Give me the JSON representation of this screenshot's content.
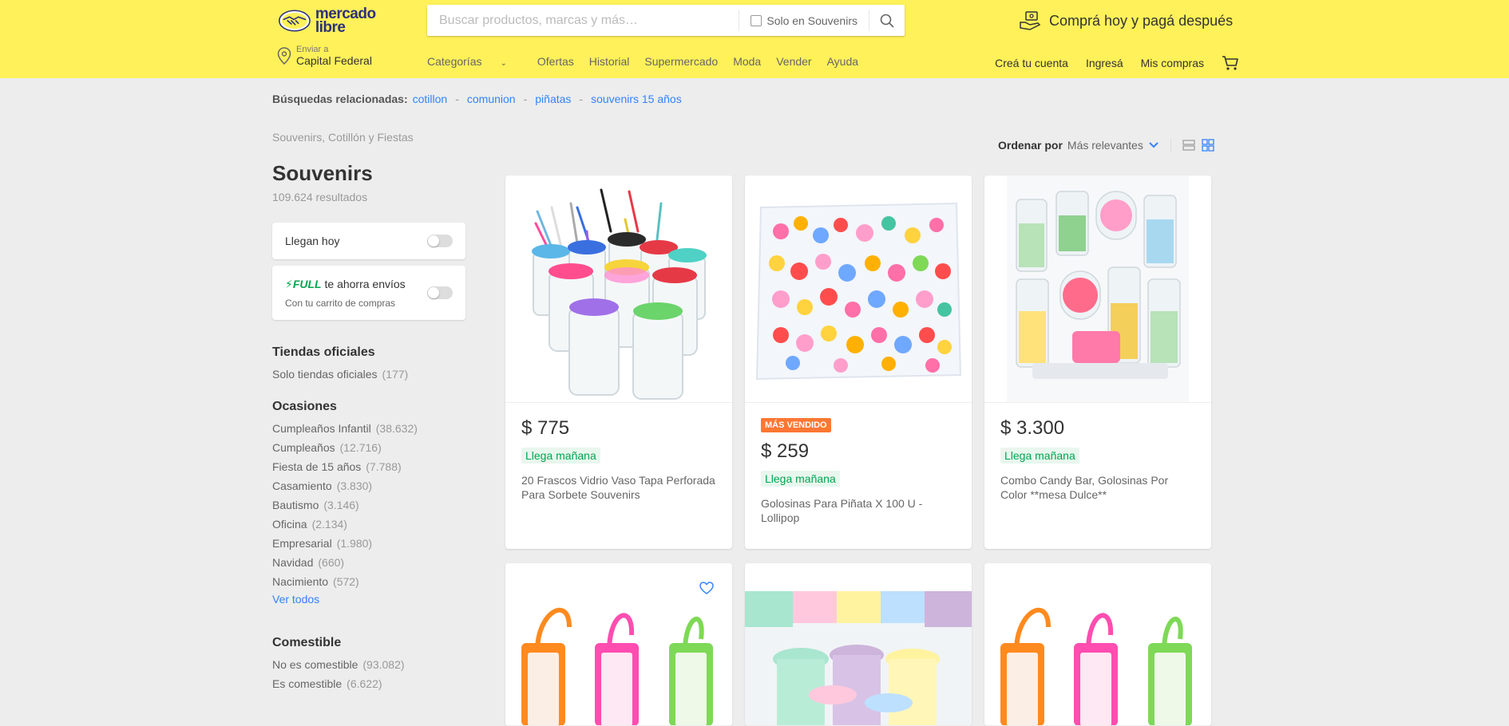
{
  "header": {
    "logo_text": "mercado libre",
    "search_placeholder": "Buscar productos, marcas y más…",
    "only_in_label": "Solo en Souvenirs",
    "promo_text": "Comprá hoy y pagá después",
    "location": {
      "small": "Enviar a",
      "city": "Capital Federal"
    },
    "nav": [
      "Categorías",
      "Ofertas",
      "Historial",
      "Supermercado",
      "Moda",
      "Vender",
      "Ayuda"
    ],
    "user_nav": [
      "Creá tu cuenta",
      "Ingresá",
      "Mis compras"
    ]
  },
  "related": {
    "label": "Búsquedas relacionadas:",
    "terms": [
      "cotillon",
      "comunion",
      "piñatas",
      "souvenirs 15 años"
    ]
  },
  "sidebar": {
    "breadcrumb": "Souvenirs, Cotillón y Fiestas",
    "title": "Souvenirs",
    "results": "109.624 resultados",
    "filter_today": "Llegan hoy",
    "full_brand": "FULL",
    "full_text": "te ahorra envíos",
    "full_sub": "Con tu carrito de compras",
    "official": {
      "title": "Tiendas oficiales",
      "item": "Solo tiendas oficiales",
      "count": "(177)"
    },
    "occasions": {
      "title": "Ocasiones",
      "items": [
        {
          "label": "Cumpleaños Infantil",
          "count": "(38.632)"
        },
        {
          "label": "Cumpleaños",
          "count": "(12.716)"
        },
        {
          "label": "Fiesta de 15 años",
          "count": "(7.788)"
        },
        {
          "label": "Casamiento",
          "count": "(3.830)"
        },
        {
          "label": "Bautismo",
          "count": "(3.146)"
        },
        {
          "label": "Oficina",
          "count": "(2.134)"
        },
        {
          "label": "Empresarial",
          "count": "(1.980)"
        },
        {
          "label": "Navidad",
          "count": "(660)"
        },
        {
          "label": "Nacimiento",
          "count": "(572)"
        }
      ],
      "see_all": "Ver todos"
    },
    "edible": {
      "title": "Comestible",
      "items": [
        {
          "label": "No es comestible",
          "count": "(93.082)"
        },
        {
          "label": "Es comestible",
          "count": "(6.622)"
        }
      ]
    }
  },
  "sort": {
    "label": "Ordenar por",
    "value": "Más relevantes"
  },
  "products": [
    {
      "price": "$ 775",
      "badge": "",
      "shipping": "Llega mañana",
      "title": "20 Frascos Vidrio Vaso Tapa Perforada Para Sorbete Souvenirs"
    },
    {
      "price": "$ 259",
      "badge": "MÁS VENDIDO",
      "shipping": "Llega mañana",
      "title": "Golosinas Para Piñata X 100 U - Lollipop"
    },
    {
      "price": "$ 3.300",
      "badge": "",
      "shipping": "Llega mañana",
      "title": "Combo Candy Bar, Golosinas Por Color **mesa Dulce**"
    }
  ],
  "colors": {
    "header": "#fff159",
    "accent": "#3483fa",
    "green": "#00a650",
    "badge": "#ff7733"
  }
}
